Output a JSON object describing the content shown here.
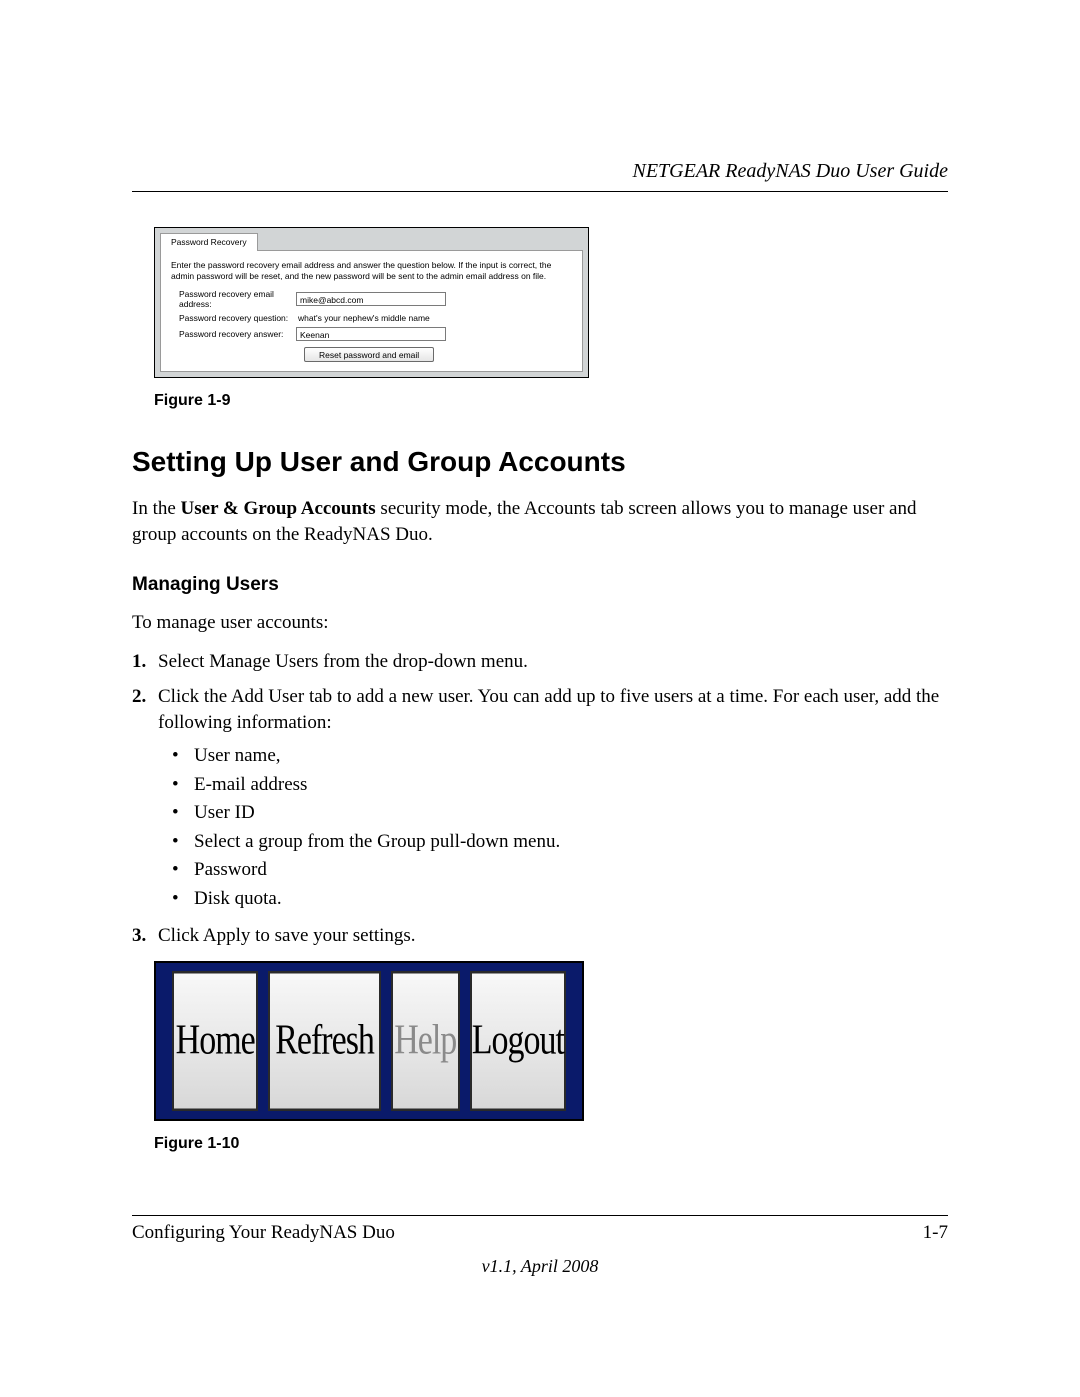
{
  "header": {
    "title": "NETGEAR ReadyNAS Duo User Guide"
  },
  "fig19": {
    "tab": "Password Recovery",
    "instructions": "Enter the password recovery email address and answer the question below. If the input is correct, the admin password will be reset, and the new password will be sent to the admin email address on file.",
    "email_label": "Password recovery email address:",
    "email_value": "mike@abcd.com",
    "question_label": "Password recovery question:",
    "question_value": "what's your nephew's middle name",
    "answer_label": "Password recovery answer:",
    "answer_value": "Keenan",
    "button": "Reset password and email",
    "caption": "Figure 1-9"
  },
  "section": {
    "heading": "Setting Up User and Group Accounts",
    "intro_pre": "In the ",
    "intro_bold": "User & Group Accounts",
    "intro_post": " security mode, the Accounts tab screen allows you to manage user and group accounts on the ReadyNAS Duo.",
    "sub_heading": "Managing Users",
    "lead": "To manage user accounts:",
    "step1_num": "1.",
    "step1_pre": "Select ",
    "step1_bold": "Manage Users",
    "step1_post": " from the drop-down menu.",
    "step2_num": "2.",
    "step2_pre": "Click the ",
    "step2_bold": "Add User",
    "step2_post": " tab to add a new user. You can add up to five users at a time. For each user, add the following information:",
    "step2_bullets": {
      "b1": "User name,",
      "b2": "E-mail address",
      "b3": "User ID",
      "b4_pre": "Select a group from the ",
      "b4_bold": "Group",
      "b4_post": " pull-down menu.",
      "b5": "Password",
      "b6": "Disk quota."
    },
    "step3_num": "3.",
    "step3_pre": "Click ",
    "step3_bold": "Apply",
    "step3_post": " to save your settings."
  },
  "fig110": {
    "home": "Home",
    "refresh": "Refresh",
    "help": "Help",
    "logout": "Logout",
    "caption": "Figure 1-10"
  },
  "footer": {
    "left": "Configuring Your ReadyNAS Duo",
    "right": "1-7",
    "version": "v1.1, April 2008"
  }
}
